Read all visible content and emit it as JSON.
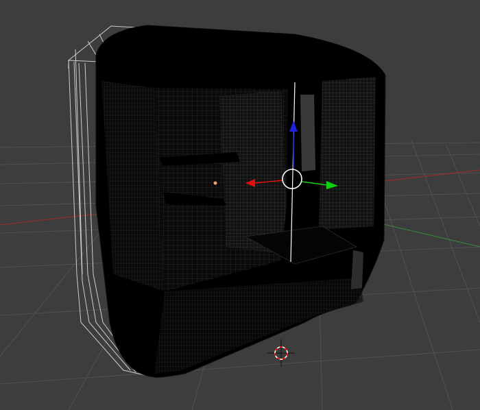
{
  "viewport": {
    "background": "#3d3d3d",
    "grid_color": "#5a5a5a",
    "mesh_color": "#000000",
    "mesh_wire_light": "#6a6a6a"
  },
  "axes": {
    "x_color": "#a52a2a",
    "y_color": "#3c8c3c",
    "z_color": "#3030d0"
  },
  "gizmo": {
    "x_arrow_color": "#e01010",
    "y_arrow_color": "#10d010",
    "z_arrow_color": "#2020e0",
    "ring_color": "#ffffff"
  },
  "cursor_3d": {
    "ring_color_a": "#ff0000",
    "ring_color_b": "#ffffff"
  },
  "origin_dot_color": "#f0a070",
  "icons": [
    "transform-gizmo-icon",
    "3d-cursor-icon",
    "object-origin-icon"
  ]
}
